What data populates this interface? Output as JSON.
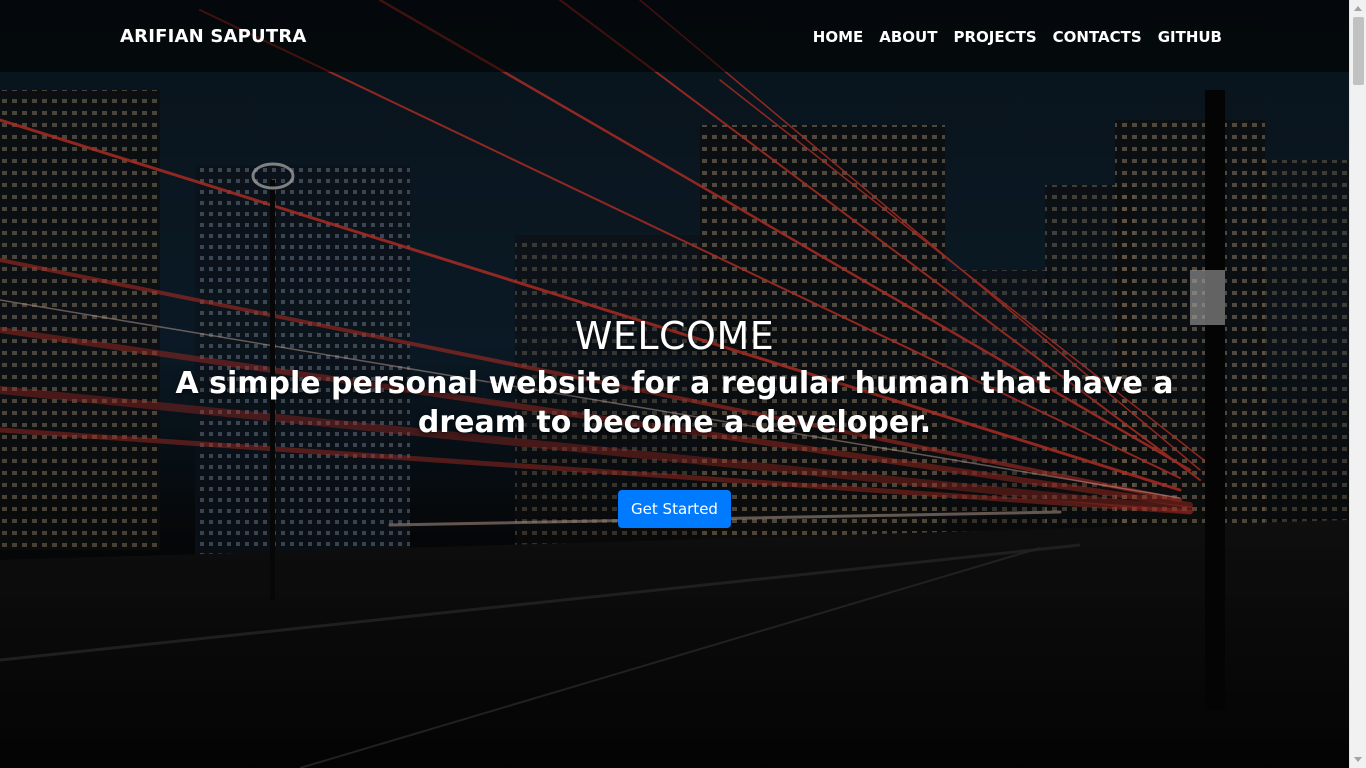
{
  "navbar": {
    "brand": "ARIFIAN SAPUTRA",
    "links": [
      "HOME",
      "ABOUT",
      "PROJECTS",
      "CONTACTS",
      "GITHUB"
    ]
  },
  "hero": {
    "title": "WELCOME",
    "subtitle": "A simple personal website for a regular human that have a dream to become a developer.",
    "button_label": "Get Started"
  },
  "colors": {
    "accent": "#007bff",
    "light_trail": "#e23a2e"
  }
}
